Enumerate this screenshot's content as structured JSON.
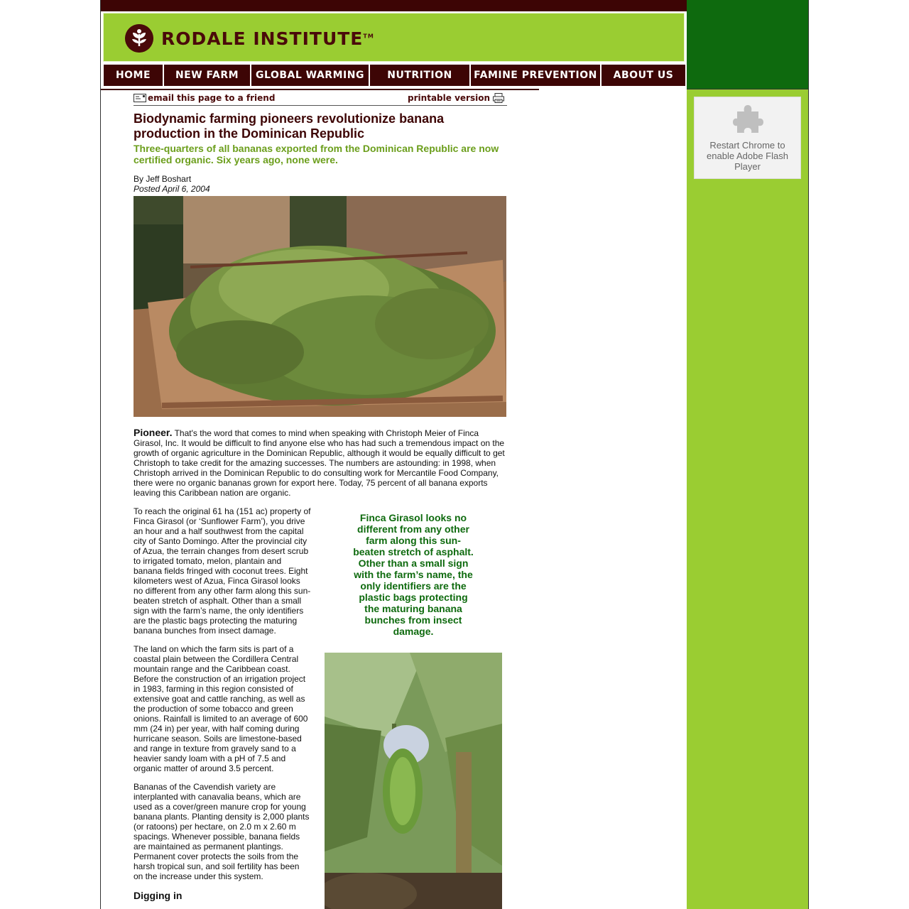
{
  "brand": {
    "name": "RODALE INSTITUTE",
    "tm": "TM"
  },
  "nav": [
    "HOME",
    "NEW FARM",
    "GLOBAL WARMING",
    "NUTRITION",
    "FAMINE PREVENTION",
    "ABOUT US"
  ],
  "utility": {
    "email": "email this page to a friend",
    "print": "printable version"
  },
  "article": {
    "title": "Biodynamic farming pioneers revolutionize banana production in the Dominican Republic",
    "deck": "Three-quarters of all bananas exported from the Dominican Republic are now certified organic. Six years ago, none were.",
    "byline": "By Jeff Boshart",
    "posted": "Posted April 6, 2004",
    "lead_kicker": "Pioneer.",
    "lead_text": "That's the word that comes to mind when speaking with Christoph Meier of Finca Girasol, Inc. It would be difficult to find anyone else who has had such a tremendous impact on the growth of organic agriculture in the Dominican Republic, although it would be equally difficult to get Christoph to take credit for the amazing successes. The numbers are astounding: in 1998, when Christoph arrived in the Dominican Republic to do consulting work for Mercantile Food Company, there were no organic bananas grown for export here. Today, 75 percent of all banana exports leaving this Caribbean nation are organic.",
    "para2": "To reach the original 61 ha (151 ac) property of Finca Girasol (or ‘Sunflower Farm’), you drive an hour and a half southwest from the capital city of Santo Domingo. After the provincial city of Azua, the terrain changes from desert scrub to irrigated tomato, melon, plantain and banana fields fringed with coconut trees. Eight kilometers west of Azua, Finca Girasol looks no different from any other farm along this sun-beaten stretch of asphalt. Other than a small sign with the farm’s name, the only identifiers are the plastic bags protecting the maturing banana bunches from insect damage.",
    "pullquote": "Finca Girasol looks no different from any other farm along this sun-beaten stretch of asphalt. Other than a small sign with the farm’s name, the only identifiers are the plastic bags protecting the maturing banana bunches from insect damage.",
    "para3": "The land on which the farm sits is part of a coastal plain between the Cordillera Central mountain range and the Caribbean coast. Before the construction of an irrigation project in 1983, farming in this region consisted of extensive goat and cattle ranching, as well as the production of some tobacco and green onions. Rainfall is limited to an average of 600 mm (24 in) per year, with half coming during hurricane season. Soils are limestone-based and range in texture from gravely sand to a heavier sandy loam with a pH of 7.5 and organic matter of around 3.5 percent.",
    "para4": "Bananas of the Cavendish variety are interplanted with canavalia beans, which are used as a cover/green manure crop for young banana plants. Planting density is 2,000 plants (or ratoons) per hectare, on 2.0 m x 2.60 m spacings. Whenever possible, banana fields are maintained as permanent plantings. Permanent cover protects the soils from the harsh tropical sun, and soil fertility has been on the increase under this system.",
    "subhead": "Digging in"
  },
  "plugin": {
    "message": "Restart Chrome to enable Adobe Flash Player"
  },
  "colors": {
    "maroon": "#3d0505",
    "lime": "#9acd32",
    "forest": "#0e6a0e"
  }
}
